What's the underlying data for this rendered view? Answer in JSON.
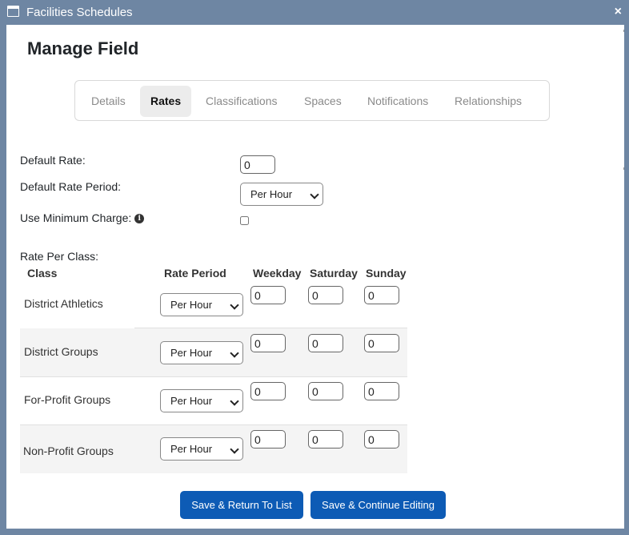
{
  "window": {
    "title": "Facilities Schedules",
    "close_glyph": "×"
  },
  "page": {
    "title": "Manage Field"
  },
  "tabs": [
    "Details",
    "Rates",
    "Classifications",
    "Spaces",
    "Notifications",
    "Relationships"
  ],
  "active_tab": "Rates",
  "form": {
    "default_rate_label": "Default Rate:",
    "default_rate_value": "0",
    "default_rate_period_label": "Default Rate Period:",
    "default_rate_period_value": "Per Hour",
    "use_min_charge_label": "Use Minimum Charge:",
    "use_min_charge_checked": false,
    "rate_per_class_label": "Rate Per Class:"
  },
  "table": {
    "headers": [
      "Class",
      "Rate Period",
      "Weekday",
      "Saturday",
      "Sunday"
    ],
    "rows": [
      {
        "class": "District Athletics",
        "period": "Per Hour",
        "weekday": "0",
        "saturday": "0",
        "sunday": "0"
      },
      {
        "class": "District Groups",
        "period": "Per Hour",
        "weekday": "0",
        "saturday": "0",
        "sunday": "0"
      },
      {
        "class": "For-Profit Groups",
        "period": "Per Hour",
        "weekday": "0",
        "saturday": "0",
        "sunday": "0"
      },
      {
        "class": "Non-Profit Groups",
        "period": "Per Hour",
        "weekday": "0",
        "saturday": "0",
        "sunday": "0"
      }
    ]
  },
  "buttons": {
    "save_return": "Save & Return To List",
    "save_continue": "Save & Continue Editing"
  },
  "icons": {
    "info": "i",
    "window": "window-icon",
    "close": "close-icon"
  },
  "colors": {
    "titlebar": "#6e86a3",
    "primary_button": "#0d5bb5",
    "row_alt": "#f4f4f4"
  }
}
